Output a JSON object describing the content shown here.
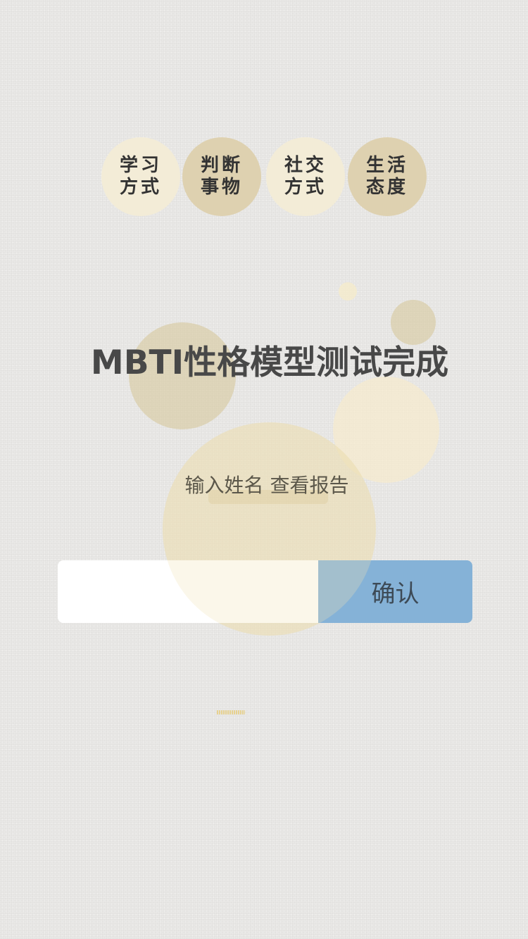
{
  "categories": [
    {
      "label": "学习方式",
      "tone": "light"
    },
    {
      "label": "判断事物",
      "tone": "dark"
    },
    {
      "label": "社交方式",
      "tone": "light"
    },
    {
      "label": "生活态度",
      "tone": "dark"
    }
  ],
  "title": "MBTI性格模型测试完成",
  "subtitle": "输入姓名 查看报告",
  "form": {
    "name_value": "",
    "confirm_label": "确认"
  },
  "colors": {
    "background": "#e9e8e6",
    "confirm_button": "#85b2d7",
    "bubble_light": "#f3ecd7",
    "bubble_dark": "#ded1b0"
  }
}
